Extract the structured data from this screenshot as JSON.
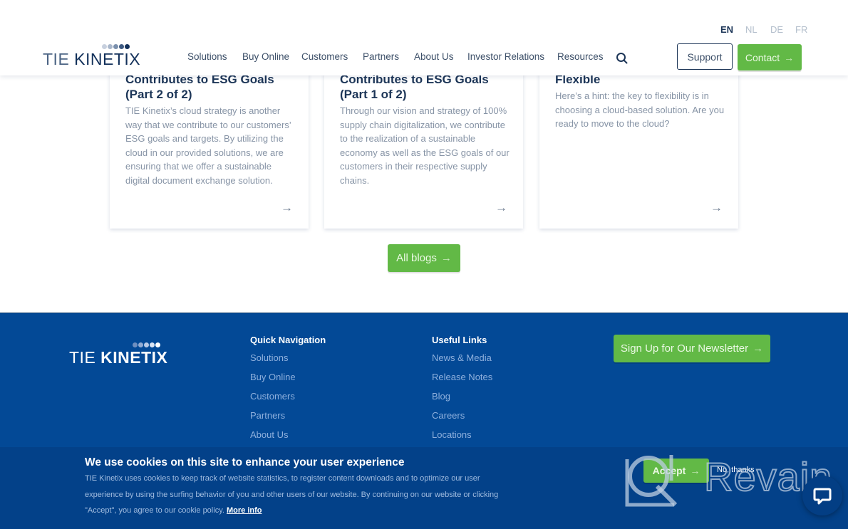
{
  "header": {
    "logo": {
      "tie": "TIE",
      "kinetix": "KINETIX"
    },
    "languages": [
      {
        "code": "EN",
        "active": true
      },
      {
        "code": "NL",
        "active": false
      },
      {
        "code": "DE",
        "active": false
      },
      {
        "code": "FR",
        "active": false
      }
    ],
    "nav": [
      "Solutions",
      "Buy Online",
      "Customers",
      "Partners",
      "About Us",
      "Investor Relations",
      "Resources"
    ],
    "search_icon": "search-icon",
    "support_label": "Support",
    "contact_label": "Contact",
    "arrow": "→"
  },
  "cards": [
    {
      "title": "Contributes to ESG Goals (Part 2 of 2)",
      "text": "TIE Kinetix’s cloud strategy is another way that we contribute to our customers’ ESG goals and targets. By utilizing the cloud in our provided solutions, we are ensuring that we offer a sustainable digital document exchange solution.",
      "arrow": "→"
    },
    {
      "title": "Contributes to ESG Goals (Part 1 of 2)",
      "text": "Through our vision and strategy of 100% supply chain digitalization, we contribute to the realization of a sustainable economy as well as the ESG goals of our customers in their respective supply chains.",
      "arrow": "→"
    },
    {
      "title": "Flexible",
      "text": "Here’s a hint: the key to flexibility is in choosing a cloud-based solution. Are you ready to move to the cloud?",
      "arrow": "→"
    }
  ],
  "all_blogs_label": "All blogs",
  "footer": {
    "logo": {
      "tie": "TIE",
      "kinetix": "KINETIX"
    },
    "quick_nav": {
      "title": "Quick Navigation",
      "links": [
        "Solutions",
        "Buy Online",
        "Customers",
        "Partners",
        "About Us"
      ]
    },
    "useful_links": {
      "title": "Useful Links",
      "links": [
        "News & Media",
        "Release Notes",
        "Blog",
        "Careers",
        "Locations"
      ]
    },
    "newsletter_label": "Sign Up for Our Newsletter"
  },
  "cookie": {
    "title": "We use cookies on this site to enhance your user experience",
    "text": "TIE Kinetix uses cookies to keep track of website statistics, to register content downloads and to optimize our user experience by using the surfing behavior of you and other users of our website. By continuing on our website or clicking \"Accept\", you agree to our cookie policy.",
    "more_info": "More info",
    "accept_label": "Accept",
    "no_thanks_label": "No, thanks"
  },
  "watermark": {
    "text": "Revain"
  },
  "colors": {
    "brand_navy": "#1c3557",
    "accent_green": "#62b946",
    "footer_blue": "#034996",
    "cookie_blue": "#034189"
  }
}
